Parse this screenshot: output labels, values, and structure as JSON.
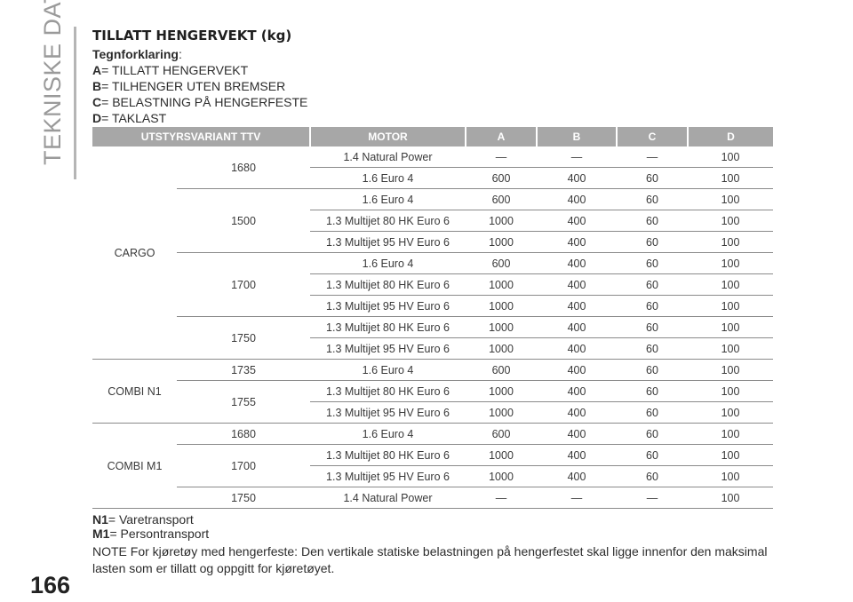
{
  "sidebar": {
    "section": "TEKNISKE DATA"
  },
  "page_number": "166",
  "title": "TILLATT HENGERVEKT (kg)",
  "legend": {
    "heading": "Tegnforklaring",
    "heading_suffix": ":",
    "items": [
      {
        "key": "A",
        "text": "= TILLATT HENGERVEKT"
      },
      {
        "key": "B",
        "text": "= TILHENGER UTEN BREMSER"
      },
      {
        "key": "C",
        "text": "= BELASTNING PÅ HENGERFESTE"
      },
      {
        "key": "D",
        "text": "= TAKLAST"
      }
    ]
  },
  "table": {
    "headers": [
      "UTSTYRSVARIANT TTV",
      "MOTOR",
      "A",
      "B",
      "C",
      "D"
    ],
    "rows": [
      {
        "variant": "CARGO",
        "ttv": "1680",
        "motor": "1.4 Natural Power",
        "a": "—",
        "b": "—",
        "c": "—",
        "d": "100"
      },
      {
        "variant": "CARGO",
        "ttv": "1680",
        "motor": "1.6 Euro 4",
        "a": "600",
        "b": "400",
        "c": "60",
        "d": "100"
      },
      {
        "variant": "CARGO",
        "ttv": "1500",
        "motor": "1.6 Euro 4",
        "a": "600",
        "b": "400",
        "c": "60",
        "d": "100"
      },
      {
        "variant": "CARGO",
        "ttv": "1500",
        "motor": "1.3 Multijet 80 HK Euro 6",
        "a": "1000",
        "b": "400",
        "c": "60",
        "d": "100"
      },
      {
        "variant": "CARGO",
        "ttv": "1500",
        "motor": "1.3 Multijet 95 HV Euro 6",
        "a": "1000",
        "b": "400",
        "c": "60",
        "d": "100"
      },
      {
        "variant": "CARGO",
        "ttv": "1700",
        "motor": "1.6 Euro 4",
        "a": "600",
        "b": "400",
        "c": "60",
        "d": "100"
      },
      {
        "variant": "CARGO",
        "ttv": "1700",
        "motor": "1.3 Multijet 80 HK Euro 6",
        "a": "1000",
        "b": "400",
        "c": "60",
        "d": "100"
      },
      {
        "variant": "CARGO",
        "ttv": "1700",
        "motor": "1.3 Multijet 95 HV Euro 6",
        "a": "1000",
        "b": "400",
        "c": "60",
        "d": "100"
      },
      {
        "variant": "CARGO",
        "ttv": "1750",
        "motor": "1.3 Multijet 80 HK Euro 6",
        "a": "1000",
        "b": "400",
        "c": "60",
        "d": "100"
      },
      {
        "variant": "CARGO",
        "ttv": "1750",
        "motor": "1.3 Multijet 95 HV Euro 6",
        "a": "1000",
        "b": "400",
        "c": "60",
        "d": "100"
      },
      {
        "variant": "COMBI N1",
        "ttv": "1735",
        "motor": "1.6 Euro 4",
        "a": "600",
        "b": "400",
        "c": "60",
        "d": "100"
      },
      {
        "variant": "COMBI N1",
        "ttv": "1755",
        "motor": "1.3 Multijet 80 HK Euro 6",
        "a": "1000",
        "b": "400",
        "c": "60",
        "d": "100"
      },
      {
        "variant": "COMBI N1",
        "ttv": "1755",
        "motor": "1.3 Multijet 95 HV Euro 6",
        "a": "1000",
        "b": "400",
        "c": "60",
        "d": "100"
      },
      {
        "variant": "COMBI M1",
        "ttv": "1680",
        "motor": "1.6 Euro 4",
        "a": "600",
        "b": "400",
        "c": "60",
        "d": "100"
      },
      {
        "variant": "COMBI M1",
        "ttv": "1700",
        "motor": "1.3 Multijet 80 HK Euro 6",
        "a": "1000",
        "b": "400",
        "c": "60",
        "d": "100"
      },
      {
        "variant": "COMBI M1",
        "ttv": "1700",
        "motor": "1.3 Multijet 95 HV Euro 6",
        "a": "1000",
        "b": "400",
        "c": "60",
        "d": "100"
      },
      {
        "variant": "COMBI M1",
        "ttv": "1750",
        "motor": "1.4 Natural Power",
        "a": "—",
        "b": "—",
        "c": "—",
        "d": "100"
      }
    ]
  },
  "footnotes": [
    {
      "key": "N1",
      "text": "= Varetransport"
    },
    {
      "key": "M1",
      "text": "= Persontransport"
    }
  ],
  "note": "NOTE For kjøretøy med hengerfeste: Den vertikale statiske belastningen på hengerfestet skal ligge innenfor den maksimal lasten som er tillatt og oppgitt for kjøretøyet.",
  "colors": {
    "header_bg": "#a7a7a7",
    "sidebar_text": "#9a9a9a"
  }
}
